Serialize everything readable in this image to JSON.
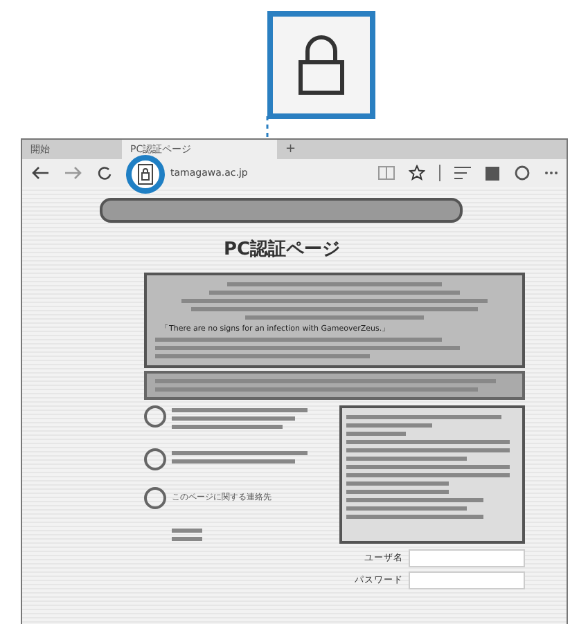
{
  "browser": {
    "tabs": [
      {
        "label": "開始",
        "selected": false
      },
      {
        "label": "PC認証ページ",
        "selected": true
      }
    ],
    "new_tab": "+",
    "url": "tamagawa.ac.jp"
  },
  "page": {
    "heading": "PC認証ページ",
    "notice_line": "「There are no signs for an infection with GameoverZeus.」",
    "options": [
      {
        "kind": "blurred"
      },
      {
        "kind": "blurred"
      },
      {
        "kind": "text",
        "text": "このページに関する連絡先"
      }
    ],
    "login": [
      {
        "label": "ユーザ名"
      },
      {
        "label": "パスワード"
      }
    ]
  }
}
